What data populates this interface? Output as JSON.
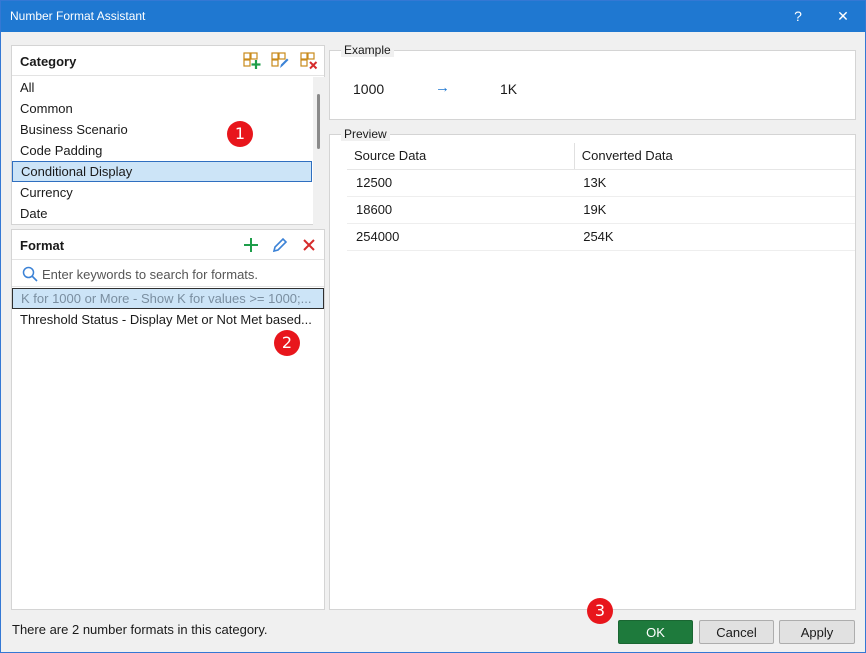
{
  "window": {
    "title": "Number Format Assistant",
    "help_label": "?",
    "close_label": "✕"
  },
  "category": {
    "header": "Category",
    "items": [
      "All",
      "Common",
      "Business Scenario",
      "Code Padding",
      "Conditional Display",
      "Currency",
      "Date"
    ],
    "selected": "Conditional Display"
  },
  "format": {
    "header": "Format",
    "search_placeholder": "Enter keywords to search for formats.",
    "items": [
      "K for 1000 or More - Show K for values >= 1000;...",
      "Threshold Status - Display Met or Not Met based..."
    ],
    "selected_index": 0
  },
  "example": {
    "label": "Example",
    "input": "1000",
    "arrow": "→",
    "output": "1K"
  },
  "preview": {
    "label": "Preview",
    "columns": [
      "Source Data",
      "Converted Data"
    ],
    "rows": [
      [
        "12500",
        "13K"
      ],
      [
        "18600",
        "19K"
      ],
      [
        "254000",
        "254K"
      ]
    ]
  },
  "status": "There are 2 number formats in this category.",
  "buttons": {
    "ok": "OK",
    "cancel": "Cancel",
    "apply": "Apply"
  },
  "badges": [
    "1",
    "2",
    "3"
  ],
  "colors": {
    "titlebar": "#1f78d1",
    "selection": "#cce4f7",
    "ok_button": "#1e7a3c",
    "badge": "#e8161c",
    "add_green": "#1e9e4a",
    "delete_red": "#d62b2b"
  }
}
